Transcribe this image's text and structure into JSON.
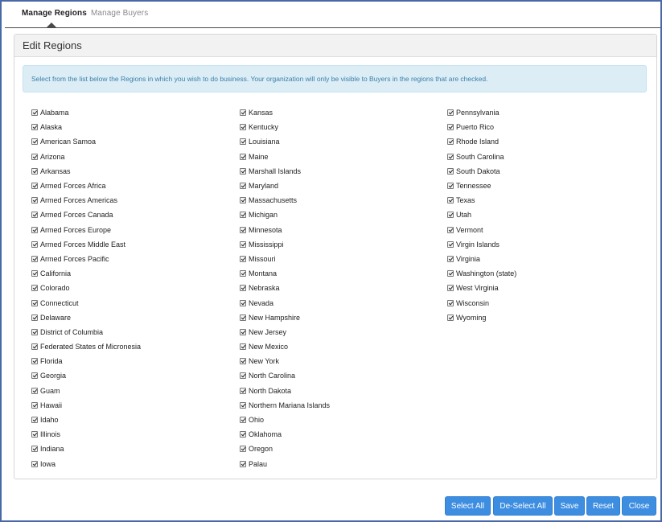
{
  "tabs": [
    {
      "label": "Manage Regions",
      "active": true
    },
    {
      "label": "Manage Buyers",
      "active": false
    }
  ],
  "panel": {
    "title": "Edit Regions",
    "info": "Select from the list below the Regions in which you wish to do business. Your organization will only be visible to Buyers in the regions that are checked."
  },
  "regions": {
    "column1": [
      "Alabama",
      "Alaska",
      "American Samoa",
      "Arizona",
      "Arkansas",
      "Armed Forces Africa",
      "Armed Forces Americas",
      "Armed Forces Canada",
      "Armed Forces Europe",
      "Armed Forces Middle East",
      "Armed Forces Pacific",
      "California",
      "Colorado",
      "Connecticut",
      "Delaware",
      "District of Columbia",
      "Federated States of Micronesia",
      "Florida",
      "Georgia",
      "Guam",
      "Hawaii",
      "Idaho",
      "Illinois",
      "Indiana",
      "Iowa"
    ],
    "column2": [
      "Kansas",
      "Kentucky",
      "Louisiana",
      "Maine",
      "Marshall Islands",
      "Maryland",
      "Massachusetts",
      "Michigan",
      "Minnesota",
      "Mississippi",
      "Missouri",
      "Montana",
      "Nebraska",
      "Nevada",
      "New Hampshire",
      "New Jersey",
      "New Mexico",
      "New York",
      "North Carolina",
      "North Dakota",
      "Northern Mariana Islands",
      "Ohio",
      "Oklahoma",
      "Oregon",
      "Palau"
    ],
    "column3": [
      "Pennsylvania",
      "Puerto Rico",
      "Rhode Island",
      "South Carolina",
      "South Dakota",
      "Tennessee",
      "Texas",
      "Utah",
      "Vermont",
      "Virgin Islands",
      "Virginia",
      "Washington (state)",
      "West Virginia",
      "Wisconsin",
      "Wyoming"
    ],
    "all_checked": true
  },
  "buttons": {
    "select_all": "Select All",
    "deselect_all": "De-Select All",
    "save": "Save",
    "reset": "Reset",
    "close": "Close"
  },
  "colors": {
    "frame_border": "#4a68a8",
    "button_bg": "#3d8de0",
    "info_bg": "#dcedf6",
    "info_text": "#3b7fa8"
  }
}
